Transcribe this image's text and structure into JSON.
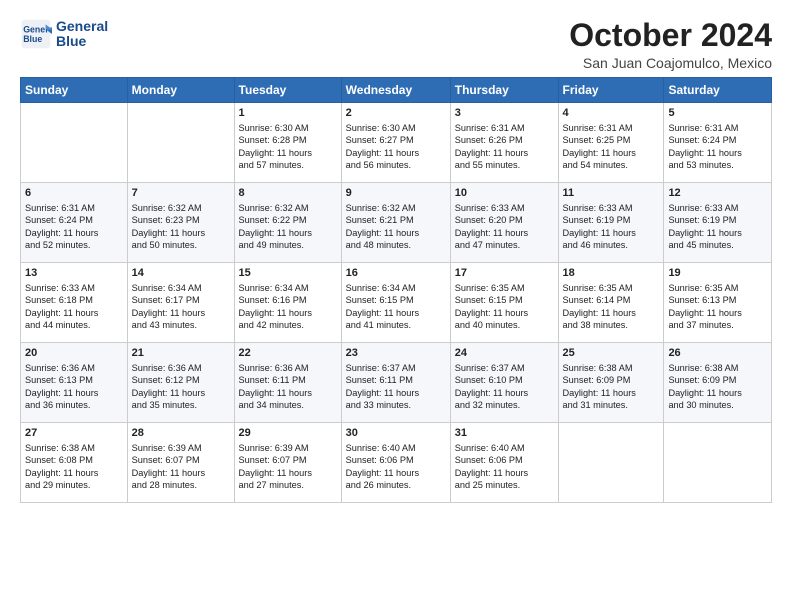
{
  "logo": {
    "line1": "General",
    "line2": "Blue"
  },
  "title": "October 2024",
  "subtitle": "San Juan Coajomulco, Mexico",
  "days_of_week": [
    "Sunday",
    "Monday",
    "Tuesday",
    "Wednesday",
    "Thursday",
    "Friday",
    "Saturday"
  ],
  "weeks": [
    [
      {
        "day": "",
        "info": ""
      },
      {
        "day": "",
        "info": ""
      },
      {
        "day": "1",
        "info": "Sunrise: 6:30 AM\nSunset: 6:28 PM\nDaylight: 11 hours\nand 57 minutes."
      },
      {
        "day": "2",
        "info": "Sunrise: 6:30 AM\nSunset: 6:27 PM\nDaylight: 11 hours\nand 56 minutes."
      },
      {
        "day": "3",
        "info": "Sunrise: 6:31 AM\nSunset: 6:26 PM\nDaylight: 11 hours\nand 55 minutes."
      },
      {
        "day": "4",
        "info": "Sunrise: 6:31 AM\nSunset: 6:25 PM\nDaylight: 11 hours\nand 54 minutes."
      },
      {
        "day": "5",
        "info": "Sunrise: 6:31 AM\nSunset: 6:24 PM\nDaylight: 11 hours\nand 53 minutes."
      }
    ],
    [
      {
        "day": "6",
        "info": "Sunrise: 6:31 AM\nSunset: 6:24 PM\nDaylight: 11 hours\nand 52 minutes."
      },
      {
        "day": "7",
        "info": "Sunrise: 6:32 AM\nSunset: 6:23 PM\nDaylight: 11 hours\nand 50 minutes."
      },
      {
        "day": "8",
        "info": "Sunrise: 6:32 AM\nSunset: 6:22 PM\nDaylight: 11 hours\nand 49 minutes."
      },
      {
        "day": "9",
        "info": "Sunrise: 6:32 AM\nSunset: 6:21 PM\nDaylight: 11 hours\nand 48 minutes."
      },
      {
        "day": "10",
        "info": "Sunrise: 6:33 AM\nSunset: 6:20 PM\nDaylight: 11 hours\nand 47 minutes."
      },
      {
        "day": "11",
        "info": "Sunrise: 6:33 AM\nSunset: 6:19 PM\nDaylight: 11 hours\nand 46 minutes."
      },
      {
        "day": "12",
        "info": "Sunrise: 6:33 AM\nSunset: 6:19 PM\nDaylight: 11 hours\nand 45 minutes."
      }
    ],
    [
      {
        "day": "13",
        "info": "Sunrise: 6:33 AM\nSunset: 6:18 PM\nDaylight: 11 hours\nand 44 minutes."
      },
      {
        "day": "14",
        "info": "Sunrise: 6:34 AM\nSunset: 6:17 PM\nDaylight: 11 hours\nand 43 minutes."
      },
      {
        "day": "15",
        "info": "Sunrise: 6:34 AM\nSunset: 6:16 PM\nDaylight: 11 hours\nand 42 minutes."
      },
      {
        "day": "16",
        "info": "Sunrise: 6:34 AM\nSunset: 6:15 PM\nDaylight: 11 hours\nand 41 minutes."
      },
      {
        "day": "17",
        "info": "Sunrise: 6:35 AM\nSunset: 6:15 PM\nDaylight: 11 hours\nand 40 minutes."
      },
      {
        "day": "18",
        "info": "Sunrise: 6:35 AM\nSunset: 6:14 PM\nDaylight: 11 hours\nand 38 minutes."
      },
      {
        "day": "19",
        "info": "Sunrise: 6:35 AM\nSunset: 6:13 PM\nDaylight: 11 hours\nand 37 minutes."
      }
    ],
    [
      {
        "day": "20",
        "info": "Sunrise: 6:36 AM\nSunset: 6:13 PM\nDaylight: 11 hours\nand 36 minutes."
      },
      {
        "day": "21",
        "info": "Sunrise: 6:36 AM\nSunset: 6:12 PM\nDaylight: 11 hours\nand 35 minutes."
      },
      {
        "day": "22",
        "info": "Sunrise: 6:36 AM\nSunset: 6:11 PM\nDaylight: 11 hours\nand 34 minutes."
      },
      {
        "day": "23",
        "info": "Sunrise: 6:37 AM\nSunset: 6:11 PM\nDaylight: 11 hours\nand 33 minutes."
      },
      {
        "day": "24",
        "info": "Sunrise: 6:37 AM\nSunset: 6:10 PM\nDaylight: 11 hours\nand 32 minutes."
      },
      {
        "day": "25",
        "info": "Sunrise: 6:38 AM\nSunset: 6:09 PM\nDaylight: 11 hours\nand 31 minutes."
      },
      {
        "day": "26",
        "info": "Sunrise: 6:38 AM\nSunset: 6:09 PM\nDaylight: 11 hours\nand 30 minutes."
      }
    ],
    [
      {
        "day": "27",
        "info": "Sunrise: 6:38 AM\nSunset: 6:08 PM\nDaylight: 11 hours\nand 29 minutes."
      },
      {
        "day": "28",
        "info": "Sunrise: 6:39 AM\nSunset: 6:07 PM\nDaylight: 11 hours\nand 28 minutes."
      },
      {
        "day": "29",
        "info": "Sunrise: 6:39 AM\nSunset: 6:07 PM\nDaylight: 11 hours\nand 27 minutes."
      },
      {
        "day": "30",
        "info": "Sunrise: 6:40 AM\nSunset: 6:06 PM\nDaylight: 11 hours\nand 26 minutes."
      },
      {
        "day": "31",
        "info": "Sunrise: 6:40 AM\nSunset: 6:06 PM\nDaylight: 11 hours\nand 25 minutes."
      },
      {
        "day": "",
        "info": ""
      },
      {
        "day": "",
        "info": ""
      }
    ]
  ]
}
